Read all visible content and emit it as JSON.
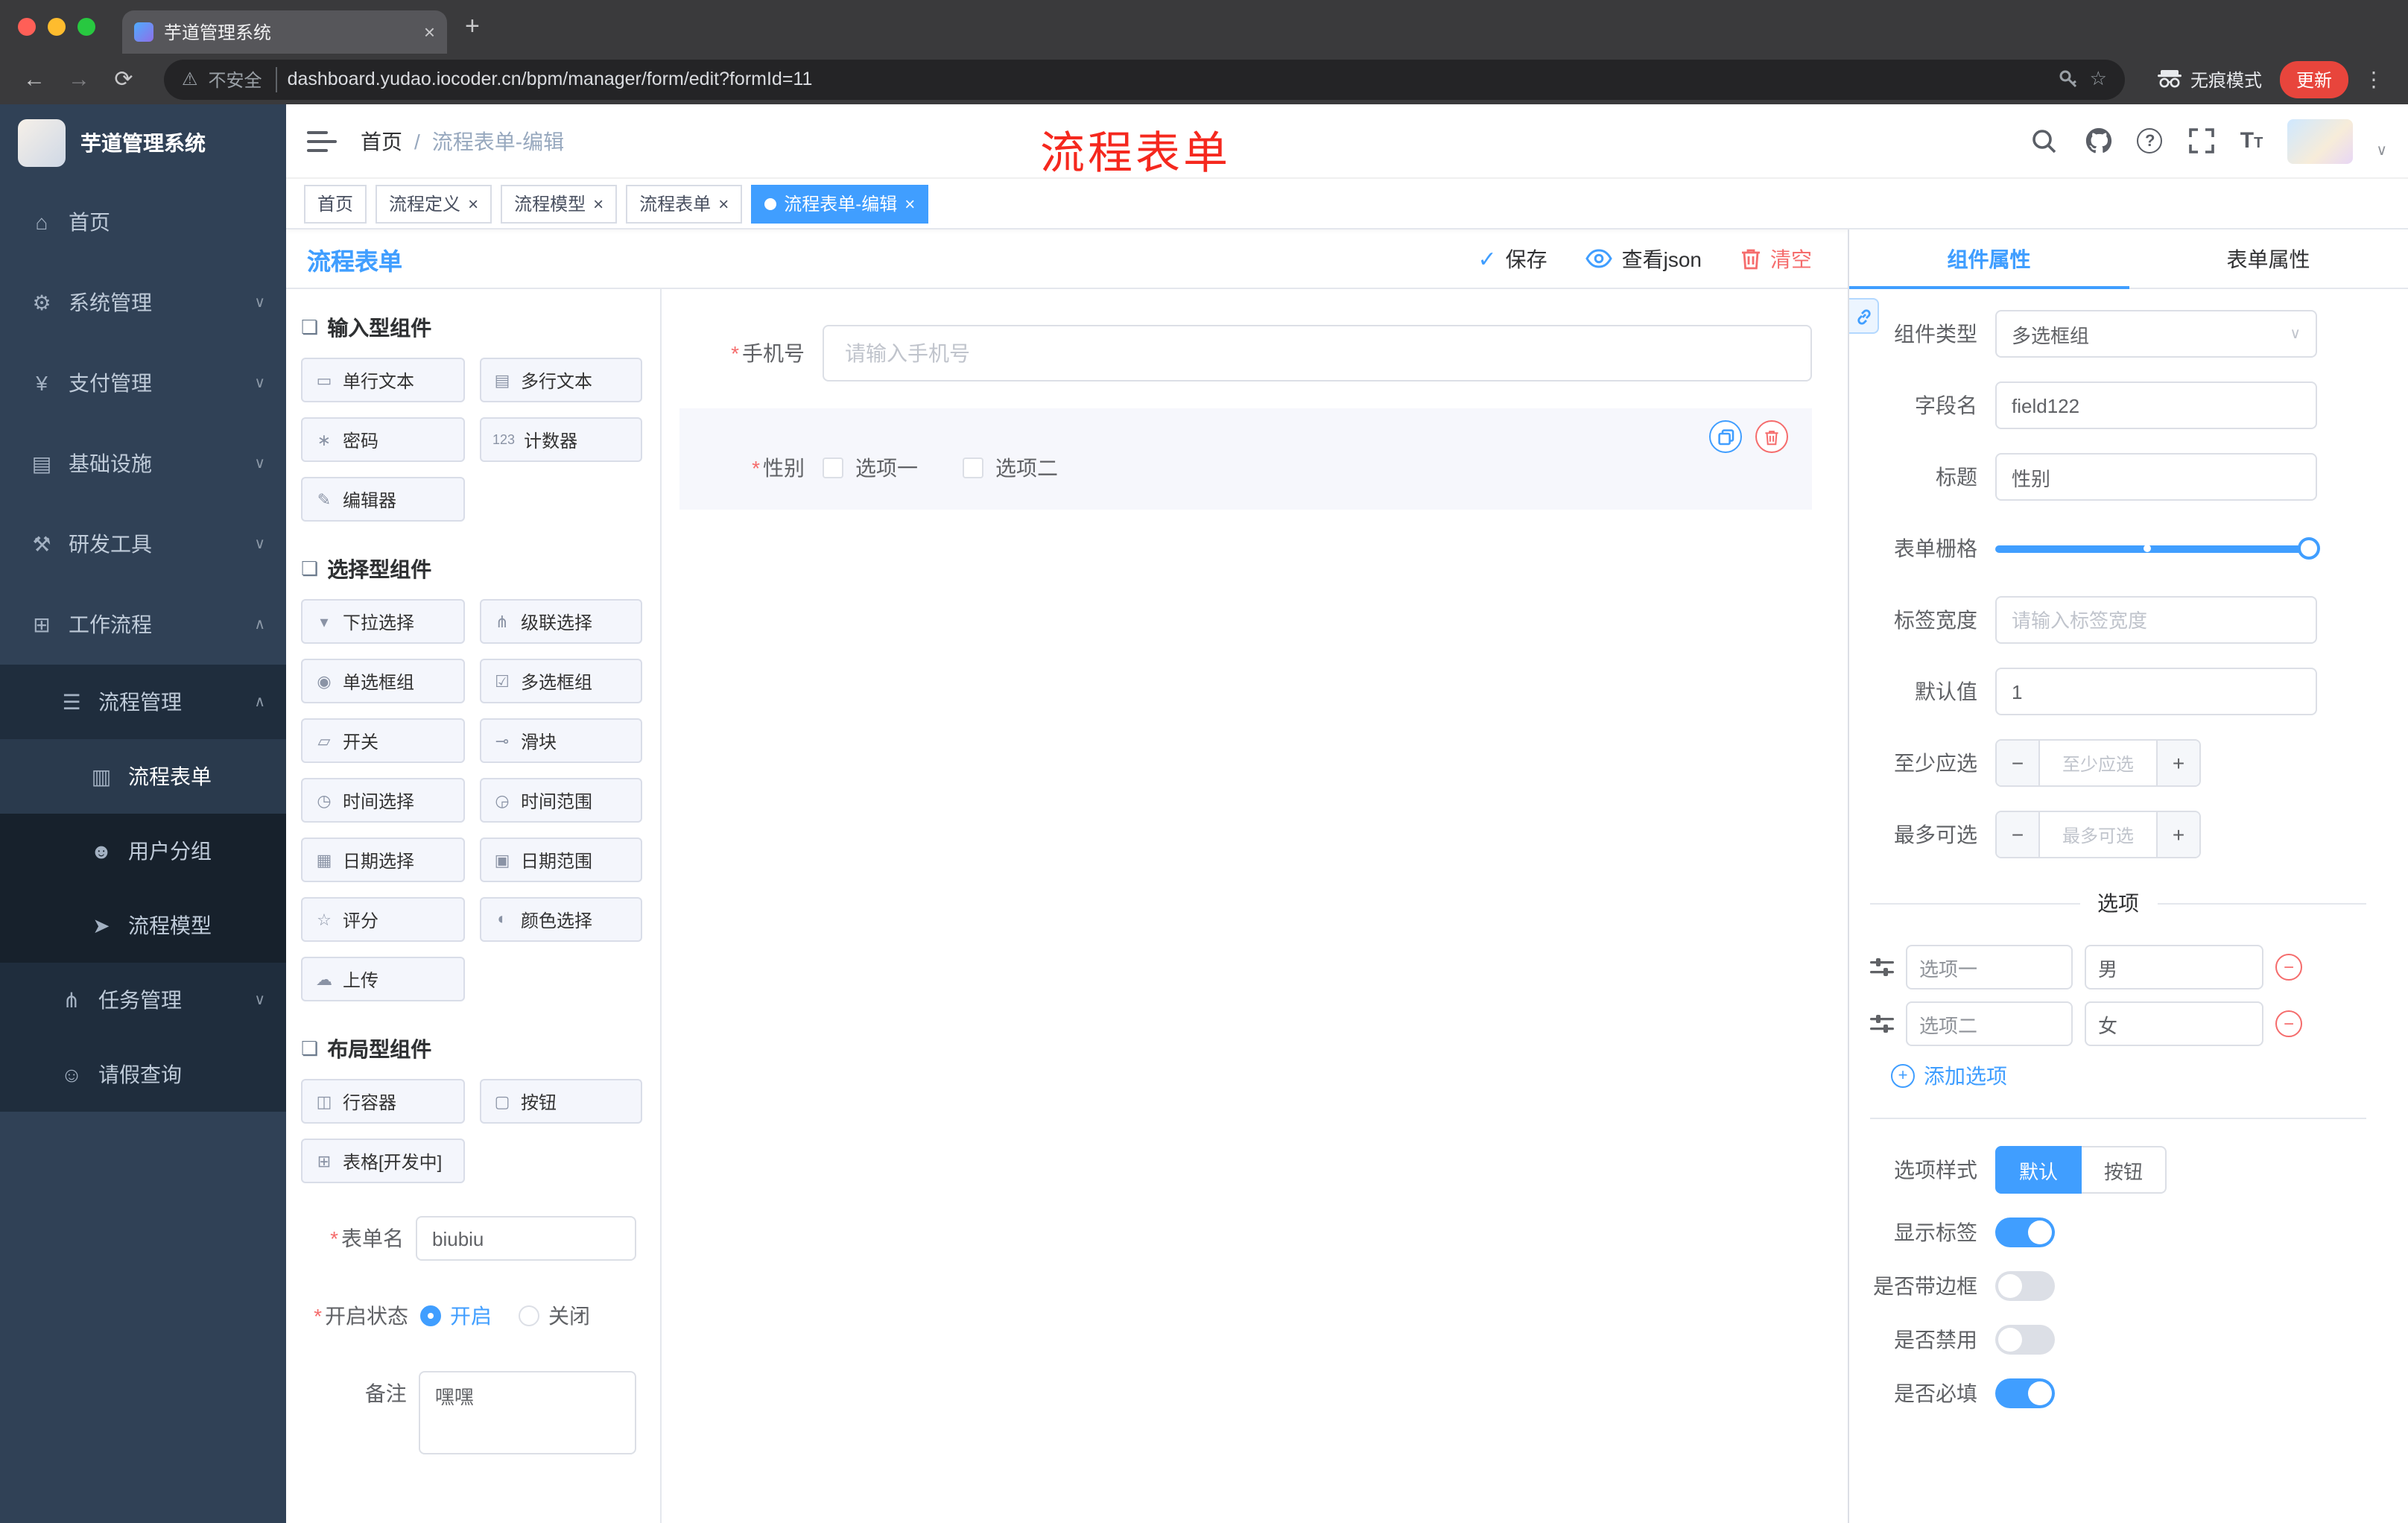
{
  "icons": {
    "asterisk": "*",
    "close": "×",
    "sep": "/",
    "chevron_down": "∨",
    "chevron_up": "∧",
    "minus": "−",
    "plus": "+",
    "more": "⋮",
    "back": "←",
    "forward": "→",
    "reload": "⟳",
    "warning": "⚠",
    "star": "☆",
    "question": "?",
    "check": "✓",
    "font_big": "T",
    "font_small": "T",
    "new_tab": "+",
    "section": "❏",
    "dash": "−"
  },
  "browser": {
    "tab_title": "芋道管理系统",
    "security": "不安全",
    "url": "dashboard.yudao.iocoder.cn/bpm/manager/form/edit?formId=11",
    "incognito": "无痕模式",
    "update": "更新"
  },
  "sidebar": {
    "title": "芋道管理系统",
    "items": [
      {
        "glyph": "⌂",
        "label": "首页"
      },
      {
        "glyph": "⚙",
        "label": "系统管理"
      },
      {
        "glyph": "¥",
        "label": "支付管理"
      },
      {
        "glyph": "▤",
        "label": "基础设施"
      },
      {
        "glyph": "⚒",
        "label": "研发工具"
      },
      {
        "glyph": "⊞",
        "label": "工作流程"
      }
    ],
    "process_mgmt": {
      "glyph": "☰",
      "label": "流程管理"
    },
    "children": [
      {
        "glyph": "▥",
        "label": "流程表单"
      },
      {
        "glyph": "☻",
        "label": "用户分组"
      },
      {
        "glyph": "➤",
        "label": "流程模型"
      }
    ],
    "task_mgmt": {
      "glyph": "⋔",
      "label": "任务管理"
    },
    "leave": {
      "glyph": "☺",
      "label": "请假查询"
    }
  },
  "header": {
    "breadcrumb_home": "首页",
    "breadcrumb_current": "流程表单-编辑",
    "overlay": "流程表单"
  },
  "tags": [
    {
      "label": "首页"
    },
    {
      "label": "流程定义"
    },
    {
      "label": "流程模型"
    },
    {
      "label": "流程表单"
    },
    {
      "label": "流程表单-编辑"
    }
  ],
  "designer": {
    "title": "流程表单",
    "save": "保存",
    "view_json": "查看json",
    "clear": "清空",
    "sections": [
      {
        "title": "输入型组件",
        "items": [
          {
            "glyph": "▭",
            "label": "单行文本"
          },
          {
            "glyph": "▤",
            "label": "多行文本"
          },
          {
            "glyph": "∗",
            "label": "密码"
          },
          {
            "glyph": "123",
            "label": "计数器"
          },
          {
            "glyph": "✎",
            "label": "编辑器"
          }
        ]
      },
      {
        "title": "选择型组件",
        "items": [
          {
            "glyph": "▾",
            "label": "下拉选择"
          },
          {
            "glyph": "⋔",
            "label": "级联选择"
          },
          {
            "glyph": "◉",
            "label": "单选框组"
          },
          {
            "glyph": "☑",
            "label": "多选框组"
          },
          {
            "glyph": "▱",
            "label": "开关"
          },
          {
            "glyph": "⊸",
            "label": "滑块"
          },
          {
            "glyph": "◷",
            "label": "时间选择"
          },
          {
            "glyph": "◶",
            "label": "时间范围"
          },
          {
            "glyph": "▦",
            "label": "日期选择"
          },
          {
            "glyph": "▣",
            "label": "日期范围"
          },
          {
            "glyph": "☆",
            "label": "评分"
          },
          {
            "glyph": "◐",
            "label": "颜色选择"
          },
          {
            "glyph": "☁",
            "label": "上传"
          }
        ]
      },
      {
        "title": "布局型组件",
        "items": [
          {
            "glyph": "◫",
            "label": "行容器"
          },
          {
            "glyph": "▢",
            "label": "按钮"
          },
          {
            "glyph": "⊞",
            "label": "表格[开发中]"
          }
        ]
      }
    ],
    "meta": {
      "form_name_label": "表单名",
      "form_name_value": "biubiu",
      "status_label": "开启状态",
      "on": "开启",
      "off": "关闭",
      "remark_label": "备注",
      "remark_value": "嘿嘿"
    },
    "canvas": {
      "phone_label": "手机号",
      "phone_placeholder": "请输入手机号",
      "gender_label": "性别",
      "opt1": "选项一",
      "opt2": "选项二"
    }
  },
  "props": {
    "tab_component": "组件属性",
    "tab_form": "表单属性",
    "type_label": "组件类型",
    "type_value": "多选框组",
    "field_label": "字段名",
    "field_value": "field122",
    "title_label": "标题",
    "title_value": "性别",
    "grid_label": "表单栅格",
    "width_label": "标签宽度",
    "width_placeholder": "请输入标签宽度",
    "default_label": "默认值",
    "default_value": "1",
    "min_label": "至少应选",
    "min_placeholder": "至少应选",
    "max_label": "最多可选",
    "max_placeholder": "最多可选",
    "options_title": "选项",
    "options": [
      {
        "name": "选项一",
        "value": "男"
      },
      {
        "name": "选项二",
        "value": "女"
      }
    ],
    "add_option": "添加选项",
    "style_label": "选项样式",
    "style_default": "默认",
    "style_button": "按钮",
    "switches": [
      {
        "label": "显示标签",
        "on": true
      },
      {
        "label": "是否带边框",
        "on": false
      },
      {
        "label": "是否禁用",
        "on": false
      },
      {
        "label": "是否必填",
        "on": true
      }
    ]
  }
}
